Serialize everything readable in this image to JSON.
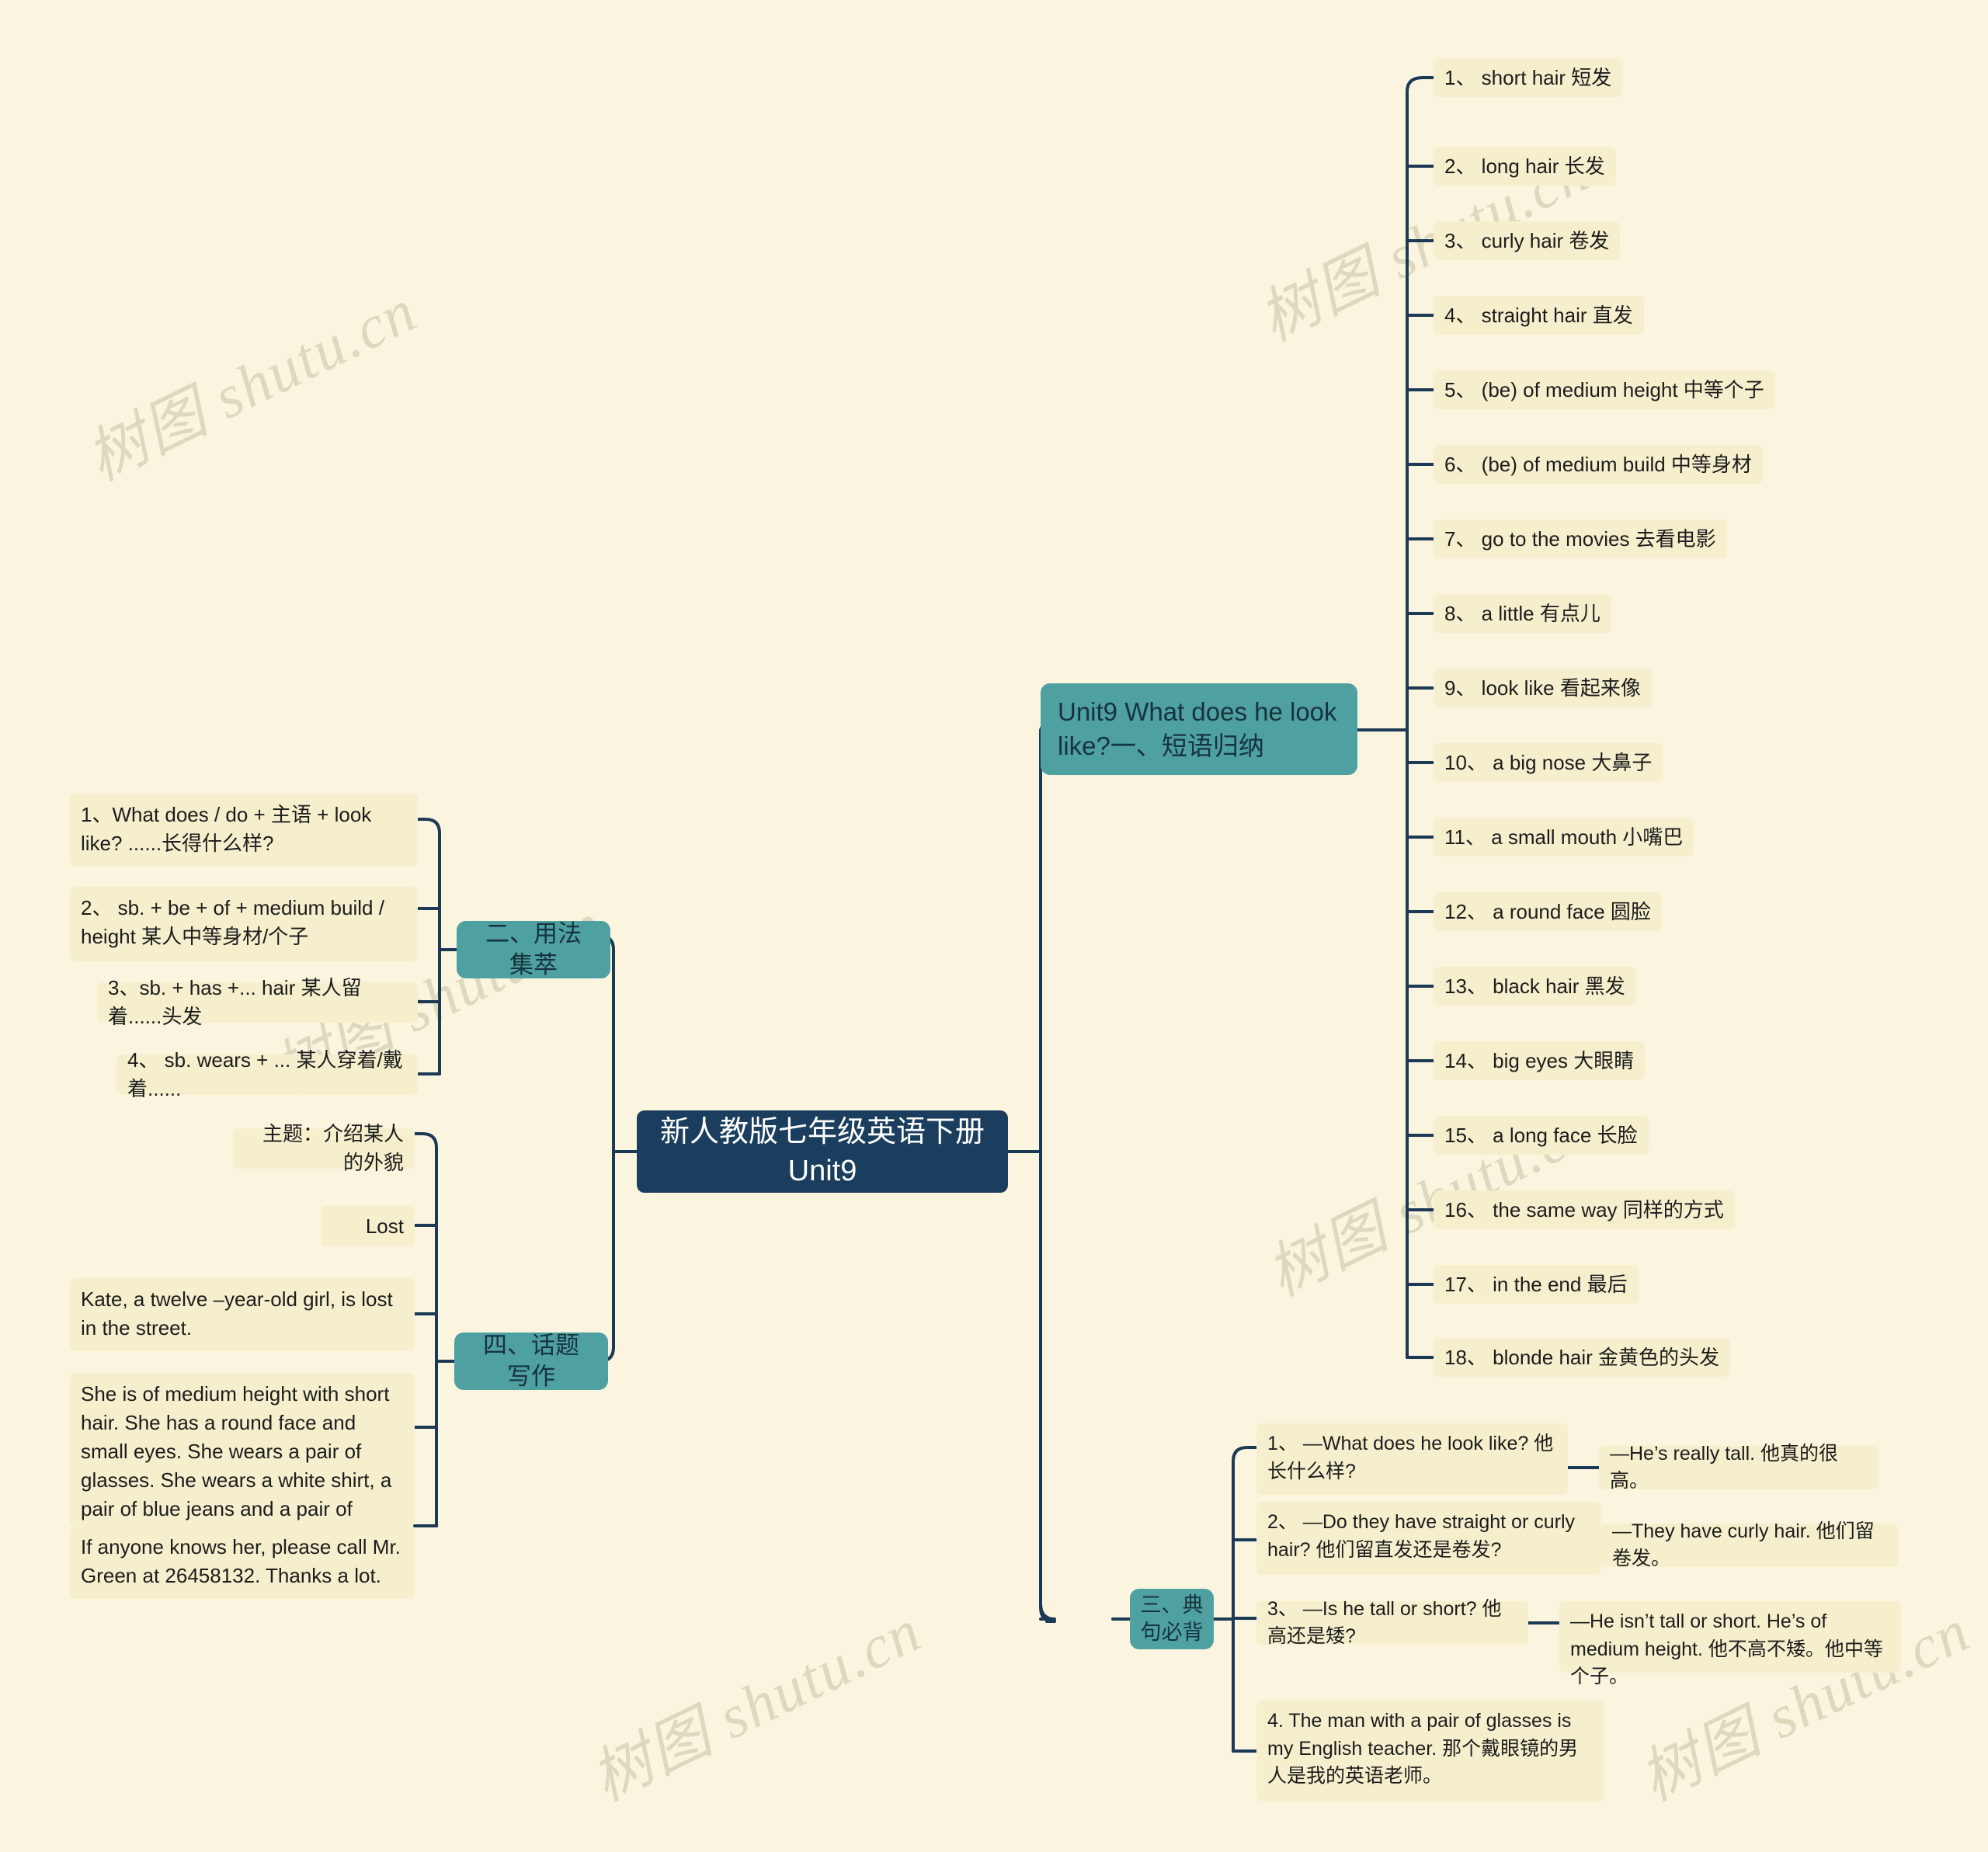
{
  "watermark": {
    "text": "树图 shutu.cn",
    "color": "#ddd9bd"
  },
  "colors": {
    "background": "#fbf5e0",
    "root_fill": "#1b3e5e",
    "root_text": "#ffffff",
    "branch_fill": "#4fa0a0",
    "branch_text": "#16333f",
    "leaf_fill": "#f5efcd",
    "leaf_text": "#1c1c1c",
    "connector": "#1c3a55"
  },
  "root": {
    "label": "新人教版七年级英语下册Unit9"
  },
  "branches": {
    "phrases": {
      "label": "Unit9 What does he look like?一、短语归纳",
      "items": [
        "1、  short hair 短发",
        "2、  long hair 长发",
        "3、  curly hair 卷发",
        "4、  straight hair 直发",
        "5、  (be) of medium height 中等个子",
        "6、  (be) of medium build 中等身材",
        "7、  go to the movies 去看电影",
        "8、  a little 有点儿",
        "9、  look like 看起来像",
        "10、  a big nose 大鼻子",
        "11、  a small mouth 小嘴巴",
        "12、  a round face 圆脸",
        "13、  black hair 黑发",
        "14、  big eyes 大眼睛",
        "15、  a long face 长脸",
        "16、  the same way 同样的方式",
        "17、  in the end 最后",
        "18、  blonde hair 金黄色的头发"
      ]
    },
    "usage": {
      "label": "二、用法集萃",
      "items": [
        "1、What does / do + 主语 + look like? ......长得什么样?",
        "2、 sb. + be + of + medium build / height 某人中等身材/个子",
        "3、sb. + has +... hair 某人留着......头发",
        "4、 sb. wears + ... 某人穿着/戴着......"
      ]
    },
    "sentences": {
      "label": "三、典句必背",
      "items": [
        {
          "question": "1、 —What does he look like? 他长什么样?",
          "answer": "—He’s really tall. 他真的很高。"
        },
        {
          "question": "2、 —Do they have straight or curly hair? 他们留直发还是卷发?",
          "answer": "—They have curly hair. 他们留卷发。"
        },
        {
          "question": "3、 —Is he tall or short? 他高还是矮?",
          "answer": "—He isn’t tall or short. He’s of medium height. 他不高不矮。他中等个子。"
        },
        {
          "question": "4. The man with a pair of glasses is my English teacher. 那个戴眼镜的男人是我的英语老师。",
          "answer": null
        }
      ]
    },
    "writing": {
      "label": "四、话题写作",
      "items": [
        "主题：介绍某人的外貌",
        "Lost",
        "Kate, a twelve –year-old girl, is lost in the street.",
        "She is of medium height with short hair. She has a round face and small eyes. She wears a pair of glasses. She wears a white shirt, a pair of blue jeans and a pair of black sports shoes.",
        "If anyone knows her, please call Mr. Green at 26458132. Thanks a lot."
      ]
    }
  }
}
